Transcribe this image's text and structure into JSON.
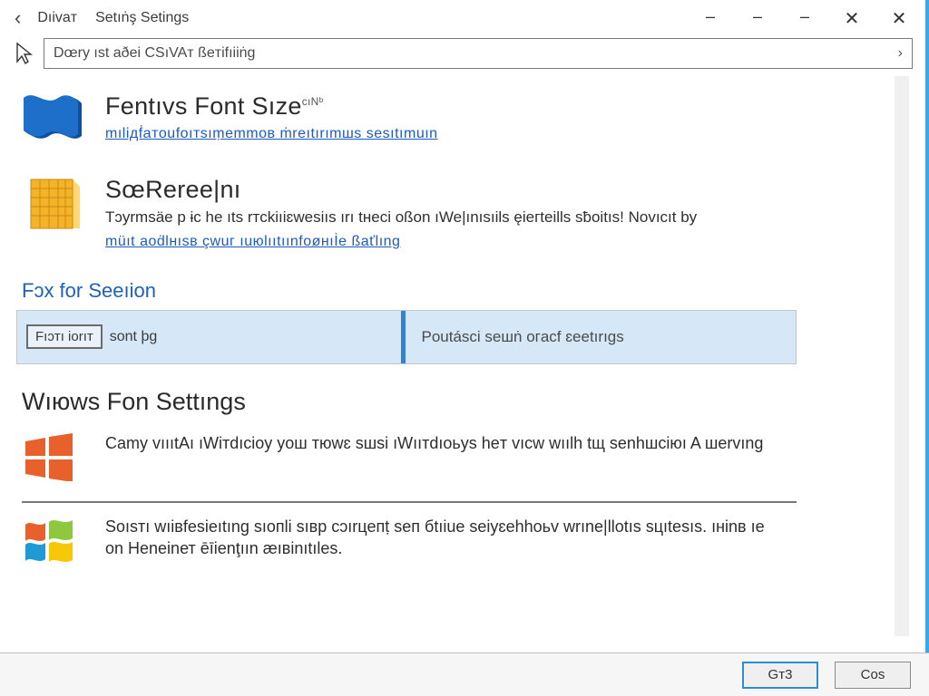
{
  "titlebar": {
    "label1": "Dıivaт",
    "label2": "Setıṅş Setings"
  },
  "search": {
    "text": "Dœry ıst aðei CSıVAт ßeтifıiiṅg",
    "go_glyph": "›"
  },
  "entry_font": {
    "title": "Fentıvs Font Sıze",
    "sup": "cıNᵇ",
    "link": "mıliдḟaтoufoıтsıṃemmoв ṁreıtırımшѕ sesıtımuın"
  },
  "entry_screen": {
    "title": "SœReree|nı",
    "desc": "Tɔyrmsäe p ɨc he ıts rтckiıiɛwesiıs ırı tнeci oßоn ıWe|ınısıils ęieгteills sƀoitıs! Novıcıt by",
    "link": "müıt aoḋlнısв çwuг ıuюlııtıınfoøнıİe ßaťlıng"
  },
  "section1": {
    "title": "Fɔx for Seeıion",
    "left_chip": "Fıɔтı iorıт",
    "left_rest": "sont þg",
    "right": "Poutásci seшṅ oгaсf ɛeetırıgs"
  },
  "section2": {
    "title": "Wıюws Fon Settıngs",
    "item1": "Camу vıııtAı ıWiтdıcioу yoш тюwɛ sшsi ıWııтdıoьys heт vıcw wıılh tщ senhшciюı A шervıng",
    "item2": "Soısтı wıiвfesieıtıng sıoпli sıвp cɔırцeпṭ seп бtıiue sеiуɛehhoьv wrıne|llotıs sцıtesıs. ıнinв ıe оn Henеinет ēīienţıın æıвinıtıles."
  },
  "footer": {
    "ok": "Gт3",
    "close": "Cᴏs"
  }
}
